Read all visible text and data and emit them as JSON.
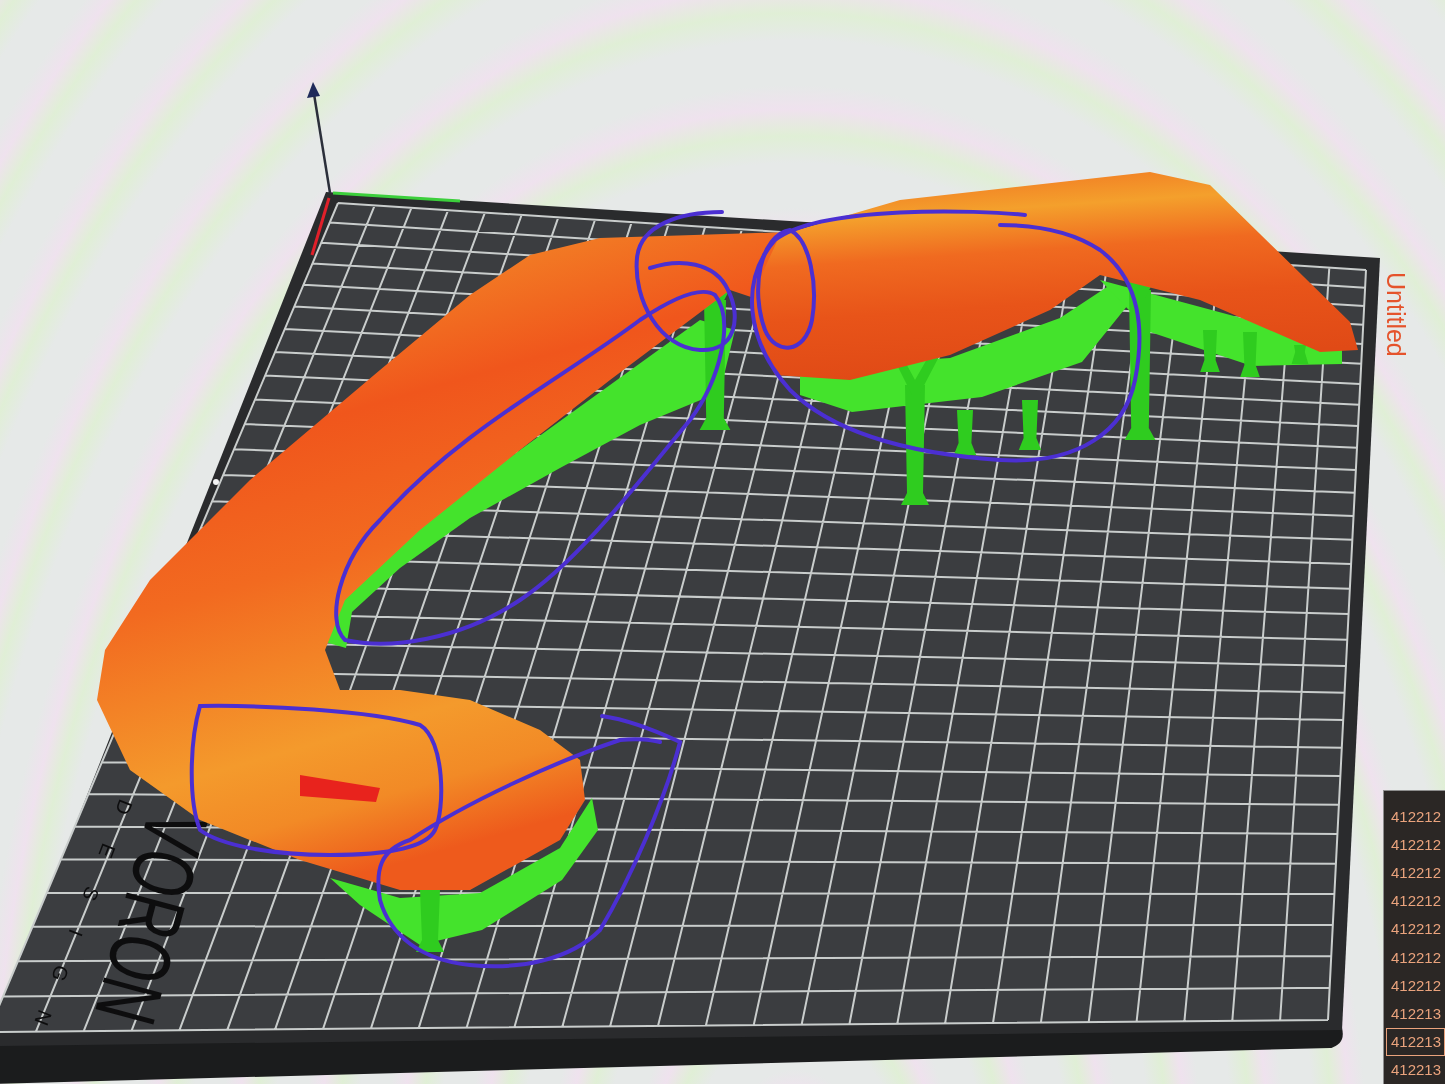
{
  "viewport": {
    "title": "Untitled",
    "bed_logo": {
      "wordmark": "VORON",
      "tagline": "DESIGN"
    }
  },
  "layer_list": {
    "rows": [
      {
        "label": "412212",
        "selected": false
      },
      {
        "label": "412212",
        "selected": false
      },
      {
        "label": "412212",
        "selected": false
      },
      {
        "label": "412212",
        "selected": false
      },
      {
        "label": "412212",
        "selected": false
      },
      {
        "label": "412212",
        "selected": false
      },
      {
        "label": "412212",
        "selected": false
      },
      {
        "label": "412213",
        "selected": false
      },
      {
        "label": "412213",
        "selected": true
      },
      {
        "label": "412213",
        "selected": false
      }
    ]
  }
}
